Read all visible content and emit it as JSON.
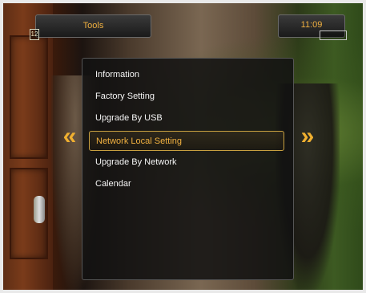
{
  "header": {
    "title": "Tools",
    "clock": "11:09",
    "badge": "12"
  },
  "menu": {
    "items": [
      {
        "label": "Information"
      },
      {
        "label": "Factory Setting"
      },
      {
        "label": "Upgrade By USB"
      },
      {
        "label": "Network Local Setting",
        "selected": true
      },
      {
        "label": "Upgrade By Network"
      },
      {
        "label": "Calendar"
      }
    ]
  },
  "arrows": {
    "left": "«",
    "right": "»"
  },
  "colors": {
    "accent": "#f0b040",
    "menu_bg": "#121212",
    "text": "#f4f4f4"
  }
}
